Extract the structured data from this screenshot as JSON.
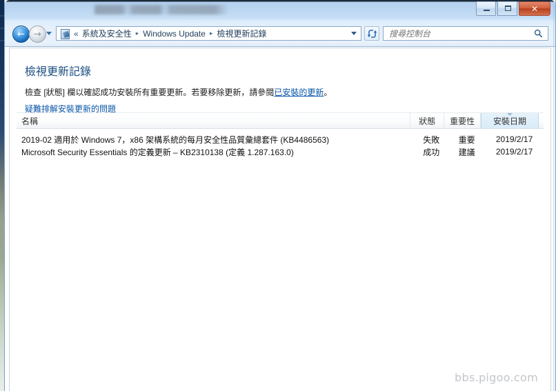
{
  "window": {
    "title_redacted": true,
    "title_placeholder": "",
    "controls": {
      "minimize_label": "–",
      "maximize_label": "□",
      "close_label": "✕"
    }
  },
  "nav": {
    "back_label": "←",
    "forward_label": "→",
    "history_label": "▾",
    "refresh_label": "refresh",
    "address_icon": "control-panel-icon",
    "double_chevron": "«",
    "breadcrumbs": [
      "系統及安全性",
      "Windows Update",
      "檢視更新記錄"
    ],
    "separator": "▸",
    "dropdown_label": "▾"
  },
  "search": {
    "placeholder": "搜尋控制台",
    "value": "",
    "icon": "search-icon"
  },
  "page": {
    "heading": "檢視更新記錄",
    "description_before": "檢查 [狀態] 欄以確認成功安裝所有重要更新。若要移除更新，請參閱",
    "description_link": "已安裝的更新",
    "description_after": "。",
    "troubleshoot_link": "疑難排解安裝更新的問題"
  },
  "list": {
    "columns": [
      {
        "label": "名稱",
        "sorted": false
      },
      {
        "label": "狀態",
        "sorted": false
      },
      {
        "label": "重要性",
        "sorted": false
      },
      {
        "label": "安裝日期",
        "sorted": true
      }
    ],
    "rows": [
      {
        "name": "2019-02 適用於 Windows 7，x86 架構系統的每月安全性品質彙總套件 (KB4486563)",
        "status": "失敗",
        "importance": "重要",
        "date": "2019/2/17"
      },
      {
        "name": "Microsoft Security Essentials 的定義更新 – KB2310138 (定義 1.287.163.0)",
        "status": "成功",
        "importance": "建議",
        "date": "2019/2/17"
      }
    ]
  },
  "watermark": {
    "text": "bbs.pigoo.com"
  },
  "colors": {
    "titlebar": "#bcd7f2",
    "heading": "#1a4d80",
    "link": "#0a56a8",
    "sorted_column": "#e6f2fb",
    "close_button": "#c2502c",
    "watermark": "#c2c6ca"
  }
}
